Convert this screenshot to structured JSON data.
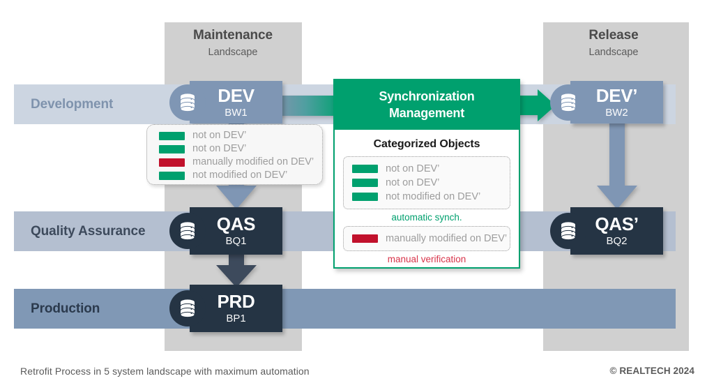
{
  "diagram": {
    "landscapes": [
      {
        "id": "maintenance",
        "title": "Maintenance",
        "subtitle": "Landscape"
      },
      {
        "id": "release",
        "title": "Release",
        "subtitle": "Landscape"
      }
    ],
    "stages": [
      {
        "id": "development",
        "label": "Development",
        "color": "#ccd5e1"
      },
      {
        "id": "quality-assurance",
        "label": "Quality Assurance",
        "color": "#b4bfd0"
      },
      {
        "id": "production",
        "label": "Production",
        "color": "#8098b5"
      }
    ],
    "systems": [
      {
        "id": "dev",
        "name": "DEV",
        "sid": "BW1",
        "color": "#7f96b4",
        "icon": "database-icon"
      },
      {
        "id": "qas",
        "name": "QAS",
        "sid": "BQ1",
        "color": "#253444",
        "icon": "database-icon"
      },
      {
        "id": "prd",
        "name": "PRD",
        "sid": "BP1",
        "color": "#253444",
        "icon": "database-icon"
      },
      {
        "id": "dev2",
        "name": "DEV’",
        "sid": "BW2",
        "color": "#7f96b4",
        "icon": "database-icon"
      },
      {
        "id": "qas2",
        "name": "QAS’",
        "sid": "BQ2",
        "color": "#253444",
        "icon": "database-icon"
      }
    ],
    "dev_legend": {
      "items": [
        {
          "color": "#00a06e",
          "label": "not on DEV’"
        },
        {
          "color": "#00a06e",
          "label": "not on DEV’"
        },
        {
          "color": "#c1112c",
          "label": "manually modified on DEV’"
        },
        {
          "color": "#00a06e",
          "label": "not modified on DEV’"
        }
      ]
    },
    "sync_panel": {
      "title_line1": "Synchronization",
      "title_line2": "Management",
      "section_title": "Categorized Objects",
      "auto_group": {
        "items": [
          {
            "color": "#00a06e",
            "label": "not on DEV’"
          },
          {
            "color": "#00a06e",
            "label": "not on DEV’"
          },
          {
            "color": "#00a06e",
            "label": "not modified on DEV’"
          }
        ],
        "caption": "automatic synch."
      },
      "manual_group": {
        "items": [
          {
            "color": "#c1112c",
            "label": "manually modified on DEV’"
          }
        ],
        "caption": "manual verification"
      }
    },
    "footer": {
      "caption": "Retrofit Process in 5 system landscape with maximum automation",
      "copyright": "© REALTECH 2024"
    },
    "colors": {
      "green": "#00a06e",
      "red": "#c1112c",
      "red_text": "#d8344a",
      "slate": "#7f96b4",
      "dark": "#253444",
      "landscape_grey": "#d0d0d0"
    }
  }
}
